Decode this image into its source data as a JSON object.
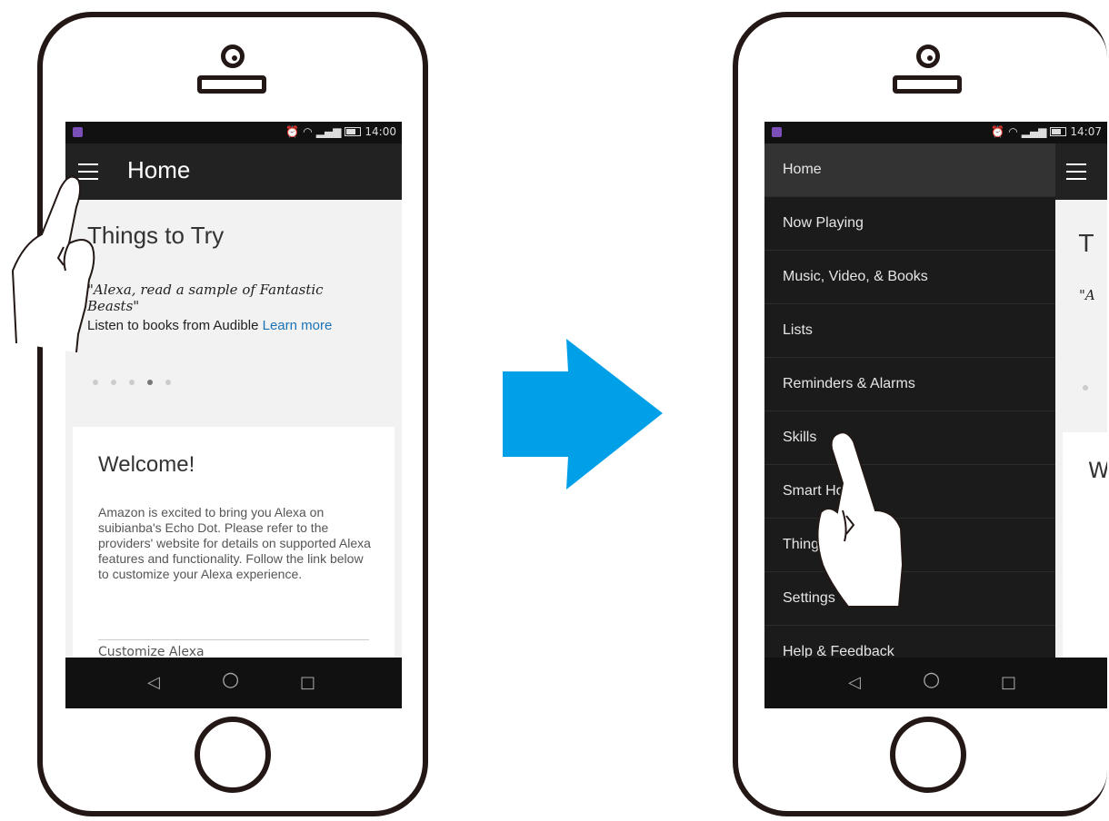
{
  "left_phone": {
    "status": {
      "time": "14:00"
    },
    "appbar": {
      "title": "Home"
    },
    "things_to_try": {
      "heading": "Things to Try",
      "quote": "\"Alexa, read a sample of Fantastic Beasts\"",
      "listen_text": "Listen to books from Audible",
      "learn_more": "Learn more"
    },
    "welcome": {
      "heading": "Welcome!",
      "body": "Amazon is excited to bring you Alexa on suibianba's Echo Dot. Please refer to the providers' website for details on supported Alexa features and functionality. Follow the link below to customize your Alexa experience.",
      "link": "Customize Alexa"
    },
    "navbar": {
      "back": "◁",
      "home": "○",
      "recents": "□"
    }
  },
  "right_phone": {
    "status": {
      "time": "14:07"
    },
    "drawer_items": [
      {
        "label": "Home"
      },
      {
        "label": "Now Playing"
      },
      {
        "label": "Music, Video, & Books"
      },
      {
        "label": "Lists"
      },
      {
        "label": "Reminders & Alarms"
      },
      {
        "label": "Skills"
      },
      {
        "label": "Smart Home"
      },
      {
        "label": "Things to Try"
      },
      {
        "label": "Settings"
      },
      {
        "label": "Help & Feedback"
      }
    ],
    "peek": {
      "title_letter": "T",
      "quote_letter": "\"A",
      "welcome_letter": "W"
    },
    "navbar": {
      "back": "◁",
      "home": "○",
      "recents": "□"
    }
  },
  "colors": {
    "arrow": "#00a0e9",
    "outline": "#231815",
    "link": "#1a73b5"
  }
}
